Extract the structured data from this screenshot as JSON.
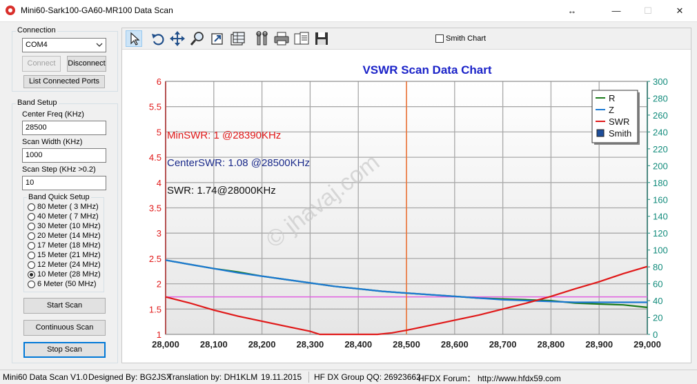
{
  "window": {
    "title": "Mini60-Sark100-GA60-MR100 Data Scan",
    "arrows_glyph": "↔",
    "min_glyph": "—",
    "max_glyph": "☐",
    "close_glyph": "✕"
  },
  "connection": {
    "group_label": "Connection",
    "port_value": "COM4",
    "connect_label": "Connect",
    "disconnect_label": "Disconnect",
    "list_ports_label": "List Connected Ports"
  },
  "band_setup": {
    "group_label": "Band Setup",
    "center_freq_label": "Center Freq  (KHz)",
    "center_freq_value": "28500",
    "scan_width_label": "Scan Width   (KHz)",
    "scan_width_value": "1000",
    "scan_step_label": "Scan Step     (KHz >0.2)",
    "scan_step_value": "10",
    "quick_label": "Band Quick Setup",
    "bands": [
      {
        "label": "80 Meter (  3 MHz)",
        "selected": false
      },
      {
        "label": "40 Meter (  7 MHz)",
        "selected": false
      },
      {
        "label": "30 Meter (10 MHz)",
        "selected": false
      },
      {
        "label": "20 Meter (14 MHz)",
        "selected": false
      },
      {
        "label": "17 Meter (18 MHz)",
        "selected": false
      },
      {
        "label": "15 Meter (21 MHz)",
        "selected": false
      },
      {
        "label": "12 Meter (24 MHz)",
        "selected": false
      },
      {
        "label": "10 Meter (28 MHz)",
        "selected": true
      },
      {
        "label": "6 Meter   (50 MHz)",
        "selected": false
      }
    ],
    "start_label": "Start Scan",
    "continuous_label": "Continuous Scan",
    "stop_label": "Stop Scan"
  },
  "toolbar": {
    "icons": [
      "pointer-icon",
      "undo-icon",
      "pan-icon",
      "zoom-icon",
      "export-icon",
      "data-table-icon",
      "properties-icon",
      "print-icon",
      "copy-icon",
      "save-icon"
    ],
    "smith_chart_label": "Smith Chart",
    "smith_chart_checked": false
  },
  "status": {
    "version": "Mini60 Data Scan V1.0",
    "designed": "Designed By: BG2JSX",
    "translation": "Translation by: DH1KLM",
    "date": "19.11.2015",
    "group": "HF DX Group QQ: 26923662",
    "forum": "HFDX Forum：  http://www.hfdx59.com"
  },
  "chart_data": {
    "type": "line",
    "title": "VSWR Scan Data Chart",
    "x_ticks": [
      "28,000",
      "28,100",
      "28,200",
      "28,300",
      "28,400",
      "28,500",
      "28,600",
      "28,700",
      "28,800",
      "28,900",
      "29,000"
    ],
    "y_left_ticks": [
      "1",
      "1.5",
      "2",
      "2.5",
      "3",
      "3.5",
      "4",
      "4.5",
      "5",
      "5.5",
      "6"
    ],
    "y_right_ticks": [
      "0",
      "20",
      "40",
      "60",
      "80",
      "100",
      "120",
      "140",
      "160",
      "180",
      "200",
      "220",
      "240",
      "260",
      "280",
      "300"
    ],
    "xlim": [
      28000,
      29000
    ],
    "ylim_left": [
      1,
      6
    ],
    "ylim_right": [
      0,
      300
    ],
    "grid": true,
    "legend_position": "top-right",
    "legend": [
      {
        "name": "R",
        "color": "#1a7a1a"
      },
      {
        "name": "Z",
        "color": "#1a78d2"
      },
      {
        "name": "SWR",
        "color": "#e01818"
      },
      {
        "name": "Smith",
        "color": "#1e4e9a"
      }
    ],
    "series": [
      {
        "name": "R",
        "axis": "right",
        "color": "#1a7a1a",
        "x": [
          28000,
          28050,
          28100,
          28150,
          28200,
          28250,
          28300,
          28350,
          28400,
          28450,
          28500,
          28550,
          28600,
          28650,
          28700,
          28750,
          28800,
          28850,
          28900,
          28950,
          29000
        ],
        "y": [
          88,
          83,
          78,
          74,
          69,
          65,
          61,
          57,
          54,
          51,
          49,
          47,
          45,
          43,
          42,
          41,
          40,
          37,
          36,
          35,
          32
        ]
      },
      {
        "name": "Z",
        "axis": "right",
        "color": "#1a78d2",
        "x": [
          28000,
          28050,
          28100,
          28150,
          28200,
          28250,
          28300,
          28350,
          28400,
          28450,
          28500,
          28550,
          28600,
          28650,
          28700,
          28750,
          28800,
          28850,
          28900,
          28950,
          29000
        ],
        "y": [
          88,
          83,
          78,
          73,
          69,
          65,
          61,
          57,
          54,
          51,
          49,
          47,
          45,
          43,
          41,
          40,
          39,
          38,
          38,
          38,
          38
        ]
      },
      {
        "name": "SWR",
        "axis": "left",
        "color": "#e01818",
        "x": [
          28000,
          28050,
          28100,
          28150,
          28200,
          28250,
          28300,
          28320,
          28350,
          28400,
          28440,
          28470,
          28500,
          28550,
          28600,
          28650,
          28700,
          28750,
          28800,
          28850,
          28900,
          28950,
          29000
        ],
        "y": [
          1.74,
          1.62,
          1.48,
          1.36,
          1.26,
          1.16,
          1.06,
          1.0,
          1.0,
          1.0,
          1.0,
          1.03,
          1.08,
          1.18,
          1.28,
          1.38,
          1.5,
          1.62,
          1.75,
          1.9,
          2.04,
          2.2,
          2.34
        ]
      }
    ],
    "reference_line": {
      "value": 1.74,
      "axis": "left",
      "color": "#e060e0"
    },
    "marker_x": 28500,
    "marker_color": "#f07030",
    "annotations": [
      {
        "text": "MinSWR: 1 @28390KHz",
        "color": "#e01818"
      },
      {
        "text": "CenterSWR: 1.08 @28500KHz",
        "color": "#1a2a8a"
      },
      {
        "text": "SWR: 1.74@28000KHz",
        "color": "#111111"
      }
    ],
    "watermark": "© jhavaj.com",
    "left_axis_color": "#e01818",
    "right_axis_color": "#0f8a7a",
    "title_color": "#1a22c8"
  }
}
